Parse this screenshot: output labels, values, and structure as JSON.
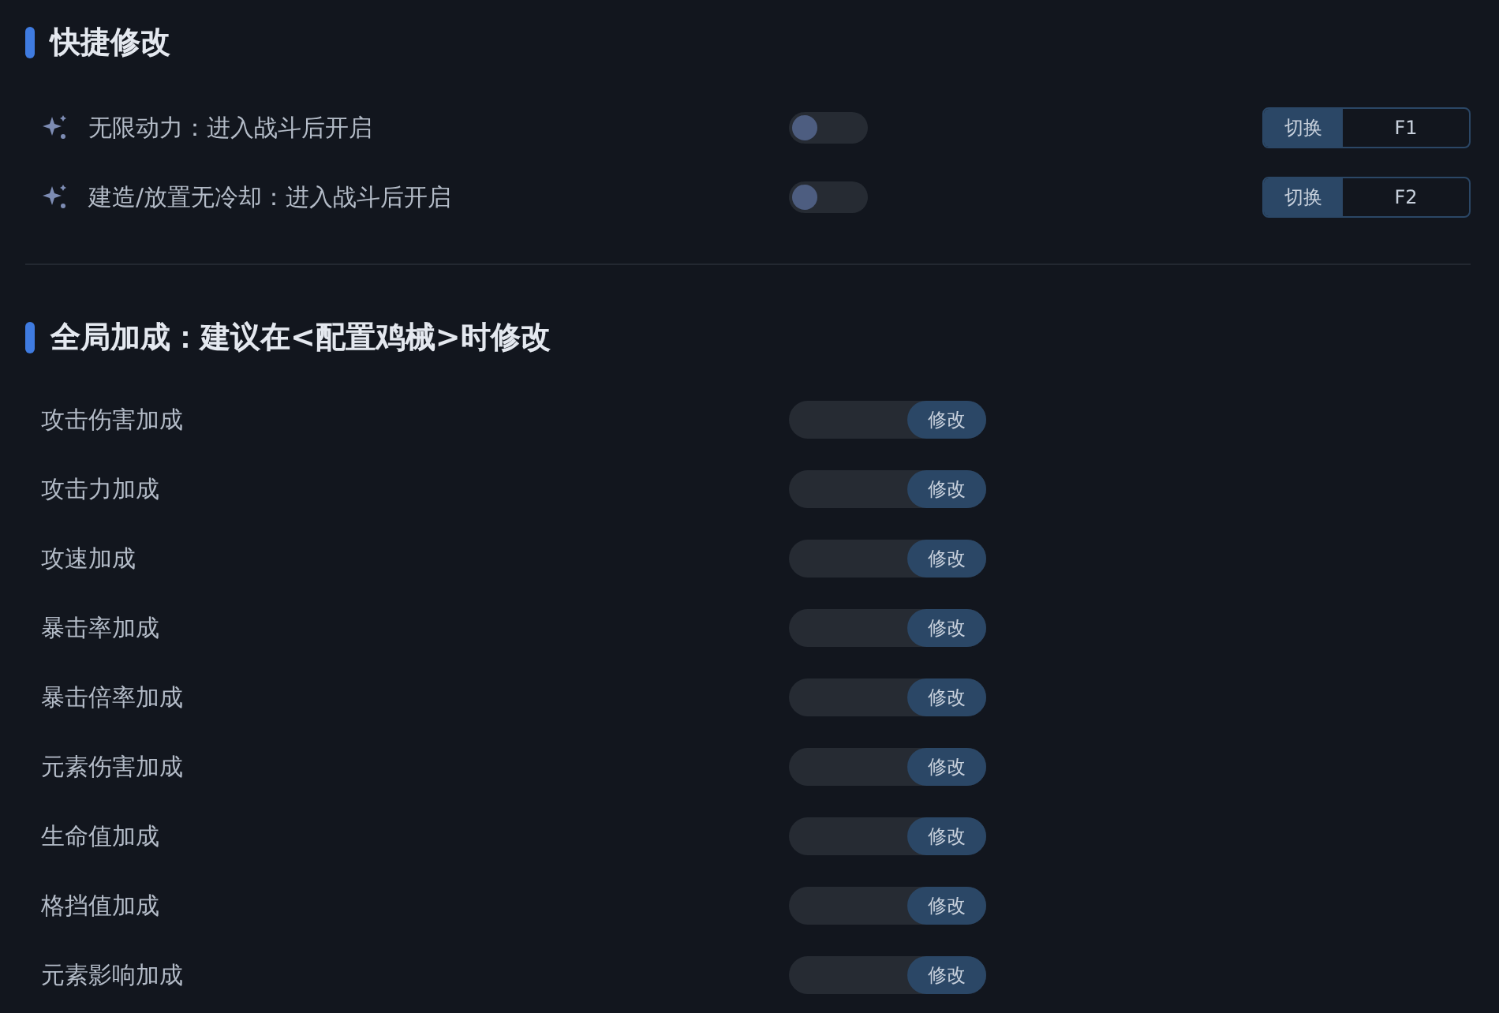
{
  "quick_section": {
    "title": "快捷修改",
    "items": [
      {
        "label": "无限动力：进入战斗后开启",
        "on": false,
        "hotkey_action": "切换",
        "hotkey": "F1"
      },
      {
        "label": "建造/放置无冷却：进入战斗后开启",
        "on": false,
        "hotkey_action": "切换",
        "hotkey": "F2"
      }
    ]
  },
  "global_section": {
    "title": "全局加成：建议在<配置鸡械>时修改",
    "items": [
      {
        "label": "攻击伤害加成",
        "button": "修改"
      },
      {
        "label": "攻击力加成",
        "button": "修改"
      },
      {
        "label": "攻速加成",
        "button": "修改"
      },
      {
        "label": "暴击率加成",
        "button": "修改"
      },
      {
        "label": "暴击倍率加成",
        "button": "修改"
      },
      {
        "label": "元素伤害加成",
        "button": "修改"
      },
      {
        "label": "生命值加成",
        "button": "修改"
      },
      {
        "label": "格挡值加成",
        "button": "修改"
      },
      {
        "label": "元素影响加成",
        "button": "修改"
      }
    ]
  }
}
